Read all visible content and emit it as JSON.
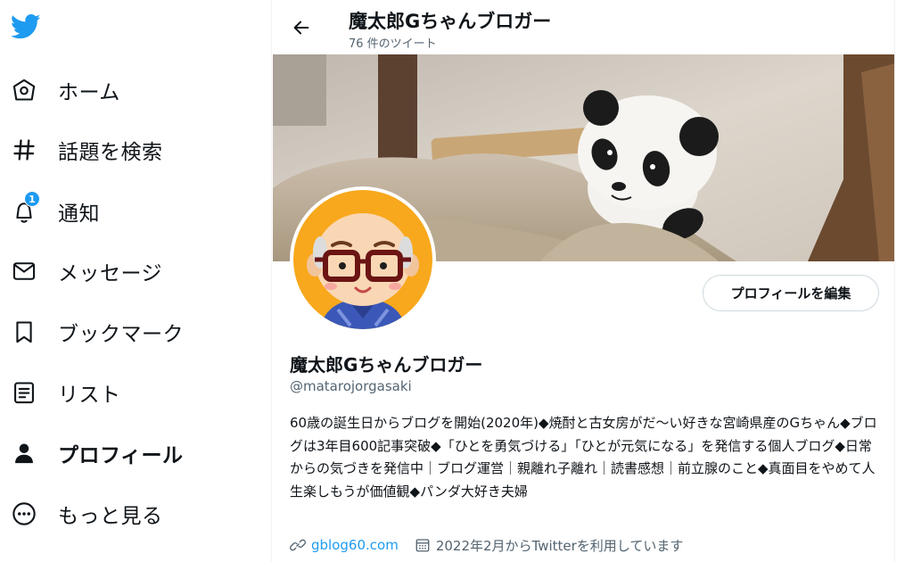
{
  "colors": {
    "accent": "#1d9bf0",
    "text": "#0f1419",
    "secondary": "#536471"
  },
  "sidebar": {
    "logo_icon": "twitter-bird-icon",
    "items": [
      {
        "label": "ホーム",
        "icon": "home-icon"
      },
      {
        "label": "話題を検索",
        "icon": "hashtag-icon"
      },
      {
        "label": "通知",
        "icon": "bell-icon",
        "badge": "1"
      },
      {
        "label": "メッセージ",
        "icon": "envelope-icon"
      },
      {
        "label": "ブックマーク",
        "icon": "bookmark-icon"
      },
      {
        "label": "リスト",
        "icon": "list-icon"
      },
      {
        "label": "プロフィール",
        "icon": "person-icon",
        "active": true
      },
      {
        "label": "もっと見る",
        "icon": "more-circle-icon"
      }
    ]
  },
  "header": {
    "title": "魔太郎Gちゃんブロガー",
    "tweet_count": "76 件のツイート"
  },
  "profile": {
    "name": "魔太郎Gちゃんブロガー",
    "handle": "@matarojorgasaki",
    "edit_label": "プロフィールを編集",
    "bio": "60歳の誕生日からブログを開始(2020年)◆焼酎と古女房がだ〜い好きな宮崎県産のGちゃん◆ブログは3年目600記事突破◆「ひとを勇気づける」「ひとが元気になる」を発信する個人ブログ◆日常からの気づきを発信中｜ブログ運営｜親離れ子離れ｜読書感想｜前立腺のこと◆真面目をやめて人生楽しもうが価値観◆パンダ大好き夫婦",
    "website": "gblog60.com",
    "joined": "2022年2月からTwitterを利用しています"
  }
}
